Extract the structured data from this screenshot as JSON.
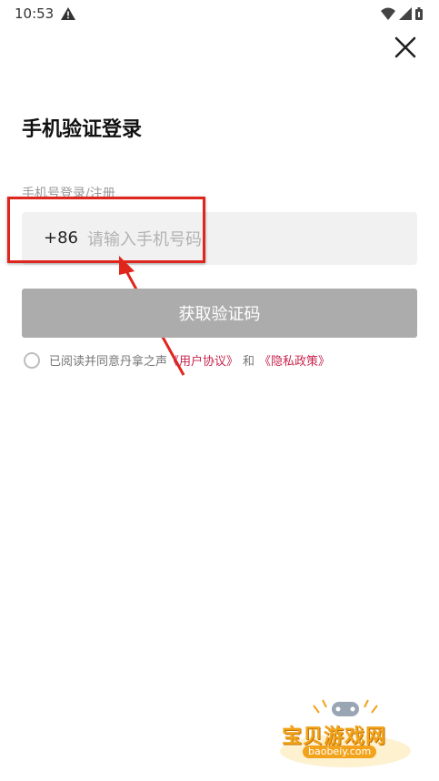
{
  "status_bar": {
    "time": "10:53"
  },
  "page": {
    "title": "手机验证登录",
    "sub_label": "手机号登录/注册"
  },
  "phone": {
    "country_code": "+86",
    "placeholder": "请输入手机号码",
    "value": ""
  },
  "buttons": {
    "get_code": "获取验证码"
  },
  "agreement": {
    "checked": false,
    "prefix": "已阅读并同意丹拿之声",
    "user_agreement": "《用户协议》",
    "connector": "和",
    "privacy_policy": "《隐私政策》"
  },
  "watermark": {
    "title": "宝贝游戏网",
    "url": "baobeiy.com"
  },
  "colors": {
    "accent_link": "#c8254e",
    "highlight": "#e0251c",
    "button_disabled": "#acacac",
    "input_bg": "#f1f1f1"
  },
  "icons": [
    "warning-icon",
    "wifi-icon",
    "signal-icon",
    "battery-icon",
    "close-icon",
    "radio-unchecked-icon"
  ]
}
